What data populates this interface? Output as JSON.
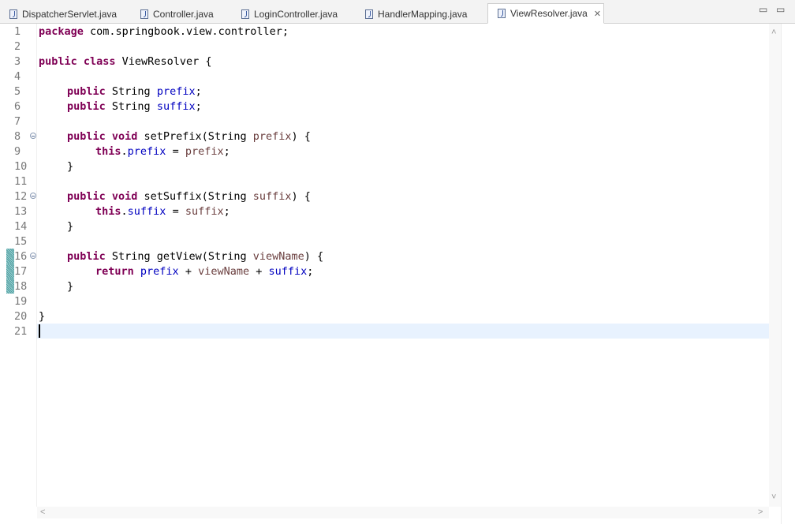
{
  "tabs": [
    {
      "label": "DispatcherServlet.java",
      "active": false
    },
    {
      "label": "Controller.java",
      "active": false
    },
    {
      "label": "LoginController.java",
      "active": false
    },
    {
      "label": "HandlerMapping.java",
      "active": false
    },
    {
      "label": "ViewResolver.java",
      "active": true
    }
  ],
  "tab_close_glyph": "✕",
  "window_controls": {
    "minimize": "▭",
    "maximize": "▭"
  },
  "scroll_glyphs": {
    "up": "˄",
    "down": "˅",
    "left": "˂",
    "right": "˃"
  },
  "line_numbers": [
    "1",
    "2",
    "3",
    "4",
    "5",
    "6",
    "7",
    "8",
    "9",
    "10",
    "11",
    "12",
    "13",
    "14",
    "15",
    "16",
    "17",
    "18",
    "19",
    "20",
    "21"
  ],
  "code": {
    "l1_kw": "package",
    "l1_rest": " com.springbook.view.controller;",
    "l3_kw": "public class",
    "l3_rest": " ViewResolver {",
    "l5_kw": "public",
    "l5_type": " String ",
    "l5_field": "prefix",
    "l5_end": ";",
    "l6_kw": "public",
    "l6_type": " String ",
    "l6_field": "suffix",
    "l6_end": ";",
    "l8_kw": "public void",
    "l8_sig": " setPrefix(String ",
    "l8_param": "prefix",
    "l8_end": ") {",
    "l9_kw": "this",
    "l9_dot": ".",
    "l9_field": "prefix",
    "l9_eq": " = ",
    "l9_param": "prefix",
    "l9_end": ";",
    "l10": "}",
    "l12_kw": "public void",
    "l12_sig": " setSuffix(String ",
    "l12_param": "suffix",
    "l12_end": ") {",
    "l13_kw": "this",
    "l13_dot": ".",
    "l13_field": "suffix",
    "l13_eq": " = ",
    "l13_param": "suffix",
    "l13_end": ";",
    "l14": "}",
    "l16_kw": "public",
    "l16_sig": " String getView(String ",
    "l16_param": "viewName",
    "l16_end": ") {",
    "l17_kw": "return",
    "l17_sp": " ",
    "l17_field1": "prefix",
    "l17_plus1": " + ",
    "l17_param": "viewName",
    "l17_plus2": " + ",
    "l17_field2": "suffix",
    "l17_end": ";",
    "l18": "}",
    "l20": "}"
  },
  "colors": {
    "keyword": "#7f0055",
    "field": "#0000c0",
    "parameter": "#6a3e3e",
    "current_line": "#e8f2fe"
  }
}
